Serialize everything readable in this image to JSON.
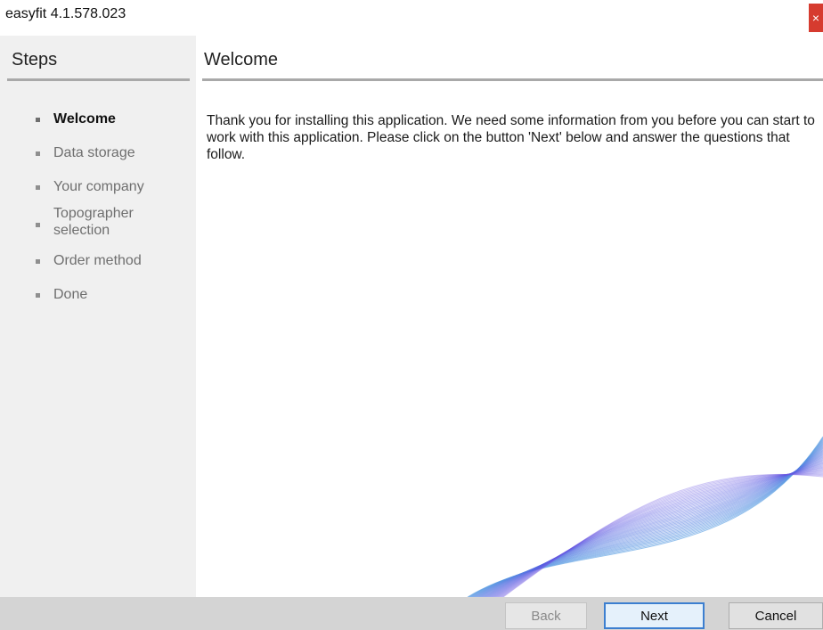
{
  "window": {
    "title": "easyfit 4.1.578.023",
    "close_glyph": "×"
  },
  "sidebar": {
    "title": "Steps",
    "items": [
      {
        "label": "Welcome",
        "active": true
      },
      {
        "label": "Data storage",
        "active": false
      },
      {
        "label": "Your company",
        "active": false
      },
      {
        "label": "Topographer selection",
        "active": false
      },
      {
        "label": "Order method",
        "active": false
      },
      {
        "label": "Done",
        "active": false
      }
    ]
  },
  "main": {
    "title": "Welcome",
    "body": "Thank you for installing this application. We need some information from you before you can start to work with this application. Please click on the button 'Next' below and answer the questions that follow."
  },
  "footer": {
    "back_label": "Back",
    "next_label": "Next",
    "cancel_label": "Cancel"
  },
  "colors": {
    "accent": "#3c7fd0",
    "close": "#d63b2f",
    "sidebar_bg": "#f0f0f0",
    "footer_bg": "#d4d4d4"
  },
  "icons": {
    "close": "close-icon",
    "bullet": "square-bullet-icon"
  }
}
